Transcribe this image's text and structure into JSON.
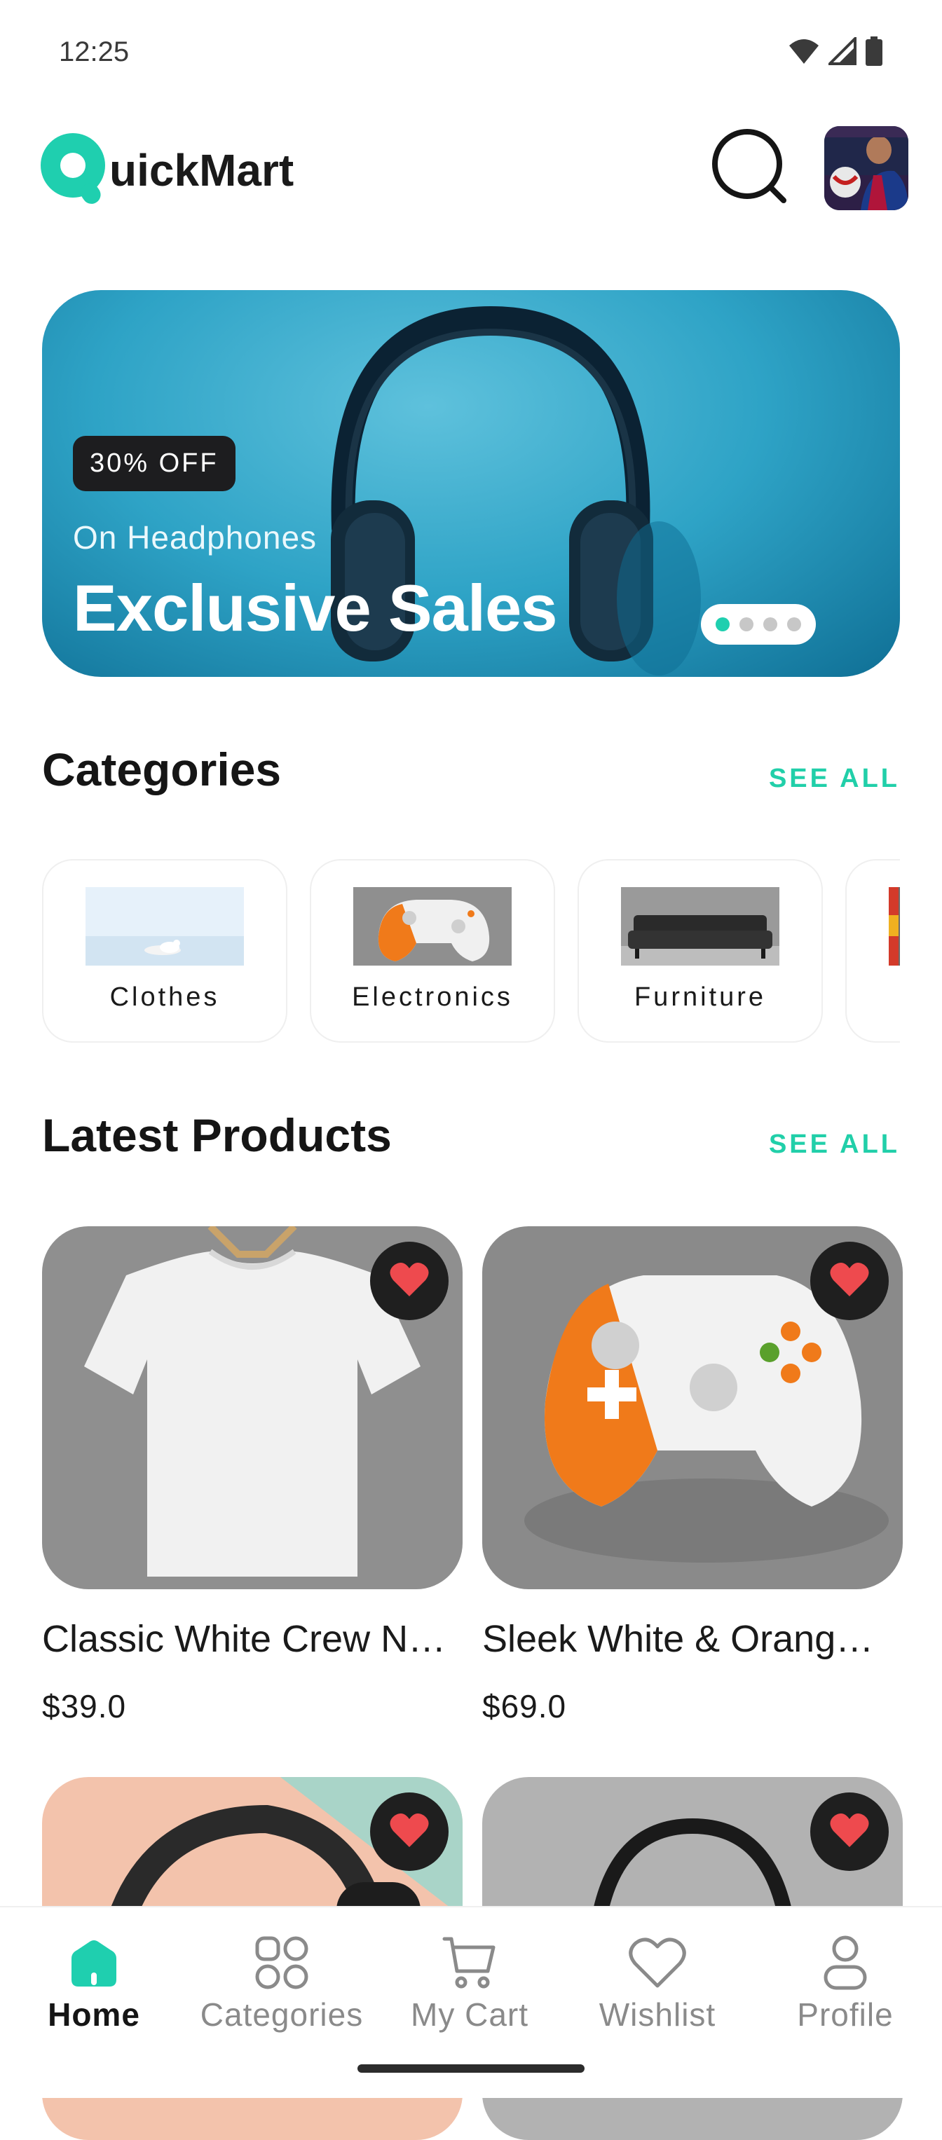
{
  "status_bar": {
    "time": "12:25",
    "icons": [
      "wifi-icon",
      "signal-icon",
      "battery-icon"
    ]
  },
  "header": {
    "logo_text": "uickMart",
    "logo_letter": "Q",
    "accent_color": "#1fcfaf",
    "search_icon": "search-icon",
    "avatar_icon": "avatar"
  },
  "banner": {
    "badge": "30% OFF",
    "subtitle": "On Headphones",
    "title": "Exclusive Sales",
    "dots_count": 4,
    "active_dot": 0
  },
  "categories": {
    "title": "Categories",
    "see_all": "SEE ALL",
    "items": [
      {
        "label": "Clothes"
      },
      {
        "label": "Electronics"
      },
      {
        "label": "Furniture"
      },
      {
        "label": ""
      }
    ]
  },
  "latest_products": {
    "title": "Latest Products",
    "see_all": "SEE ALL",
    "items": [
      {
        "name": "Classic White Crew N…",
        "price": "$39.0"
      },
      {
        "name": "Sleek White & Orang…",
        "price": "$69.0"
      },
      {
        "name": "",
        "price": ""
      },
      {
        "name": "",
        "price": ""
      }
    ]
  },
  "bottom_nav": {
    "items": [
      {
        "label": "Home",
        "icon": "home-icon",
        "active": true
      },
      {
        "label": "Categories",
        "icon": "categories-icon",
        "active": false
      },
      {
        "label": "My Cart",
        "icon": "cart-icon",
        "active": false
      },
      {
        "label": "Wishlist",
        "icon": "heart-icon",
        "active": false
      },
      {
        "label": "Profile",
        "icon": "profile-icon",
        "active": false
      }
    ]
  }
}
